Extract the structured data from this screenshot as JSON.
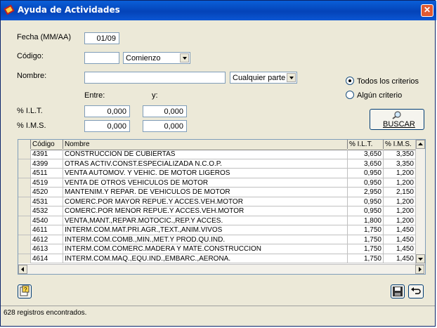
{
  "window": {
    "title": "Ayuda de Actividades",
    "close_glyph": "✕"
  },
  "form": {
    "fecha_label": "Fecha (MM/AA)",
    "fecha_value": "01/09",
    "codigo_label": "Código:",
    "codigo_value": "",
    "codigo_mode": "Comienzo",
    "nombre_label": "Nombre:",
    "nombre_value": "",
    "nombre_mode": "Cualquier parte",
    "entre_label": "Entre:",
    "y_label": "y:",
    "ilt_label": "% I.L.T.",
    "ilt_from": "0,000",
    "ilt_to": "0,000",
    "ims_label": "% I.M.S.",
    "ims_from": "0,000",
    "ims_to": "0,000",
    "radio_all": "Todos los criterios",
    "radio_any": "Algún criterio",
    "search_label": "BUSCAR"
  },
  "table": {
    "headers": [
      "Código",
      "Nombre",
      "% I.L.T.",
      "% I.M.S."
    ],
    "rows": [
      [
        "4391",
        "CONSTRUCCION DE CUBIERTAS",
        "3,650",
        "3,350"
      ],
      [
        "4399",
        "OTRAS ACTIV.CONST.ESPECIALIZADA N.C.O.P.",
        "3,650",
        "3,350"
      ],
      [
        "4511",
        "VENTA AUTOMOV. Y VEHIC. DE MOTOR LIGEROS",
        "0,950",
        "1,200"
      ],
      [
        "4519",
        "VENTA DE OTROS VEHICULOS DE MOTOR",
        "0,950",
        "1,200"
      ],
      [
        "4520",
        "MANTENIM.Y REPAR. DE VEHICULOS DE MOTOR",
        "2,950",
        "2,150"
      ],
      [
        "4531",
        "COMERC.POR MAYOR REPUE.Y ACCES.VEH.MOTOR",
        "0,950",
        "1,200"
      ],
      [
        "4532",
        "COMERC.POR MENOR REPUE.Y ACCES.VEH.MOTOR",
        "0,950",
        "1,200"
      ],
      [
        "4540",
        "VENTA,MANT.,REPAR.MOTOCIC.,REP.Y ACCES.",
        "1,800",
        "1,200"
      ],
      [
        "4611",
        "INTERM.COM.MAT.PRI.AGR.,TEXT.,ANIM.VIVOS",
        "1,750",
        "1,450"
      ],
      [
        "4612",
        "INTERM.COM.COMB.,MIN.,MET.Y PROD.QU.IND.",
        "1,750",
        "1,450"
      ],
      [
        "4613",
        "INTERM.COM.COMERC.MADERA Y MATE.CONSTRUCCION",
        "1,750",
        "1,450"
      ],
      [
        "4614",
        "INTERM.COM.MAQ.,EQU.IND.,EMBARC.,AERONA.",
        "1,750",
        "1,450"
      ]
    ]
  },
  "status": {
    "text": "628 registros encontrados."
  },
  "colors": {
    "titlebar": "#0a5fd8",
    "close": "#e05a31",
    "background": "#ece9d8"
  }
}
